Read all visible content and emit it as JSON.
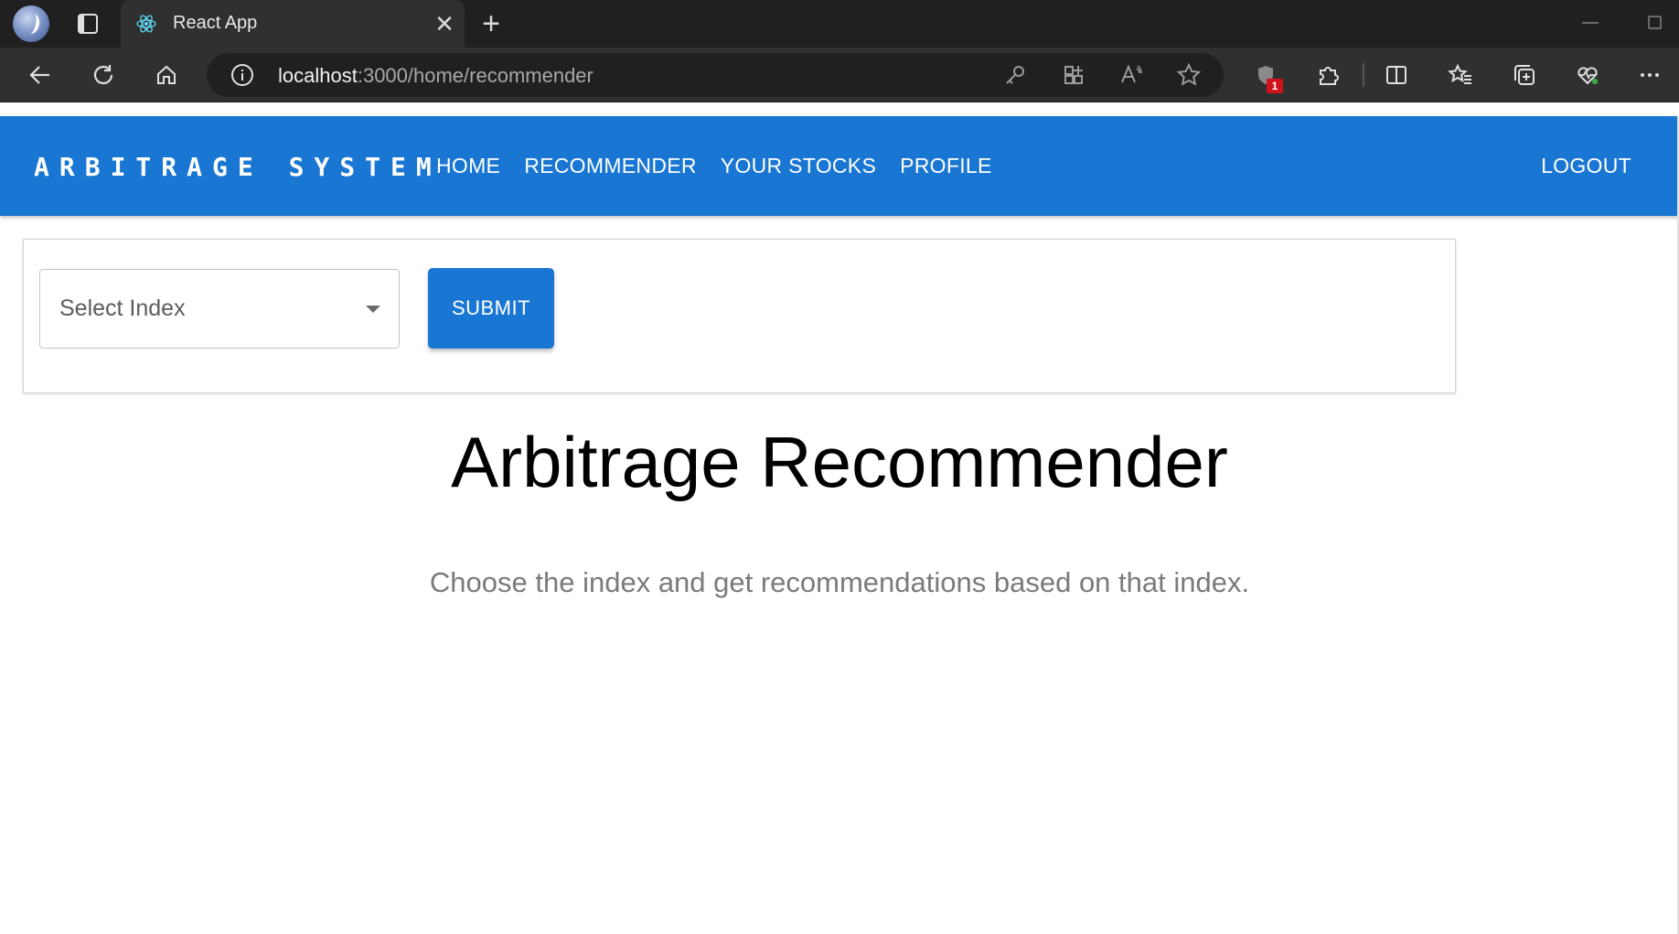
{
  "browser": {
    "tab_title": "React App",
    "url_host": "localhost",
    "url_path": ":3000/home/recommender",
    "notification_badge": "1",
    "icons": [
      "profile-avatar-icon",
      "tab-actions-icon",
      "react-favicon-icon",
      "close-icon",
      "new-tab-icon",
      "back-arrow-icon",
      "refresh-icon",
      "home-icon",
      "info-icon",
      "key-icon",
      "apps-icon",
      "read-aloud-icon",
      "star-icon",
      "shield-icon",
      "extensions-icon",
      "split-screen-icon",
      "favorites-icon",
      "collections-icon",
      "browser-essentials-icon",
      "more-icon"
    ]
  },
  "appbar": {
    "brand": "ARBITRAGE SYSTEM",
    "nav": [
      "HOME",
      "RECOMMENDER",
      "YOUR STOCKS",
      "PROFILE"
    ],
    "logout": "LOGOUT",
    "color": "#1976d2"
  },
  "form": {
    "select_label": "Select Index",
    "submit_label": "SUBMIT"
  },
  "main": {
    "title": "Arbitrage Recommender",
    "subtitle": "Choose the index and get recommendations based on that index."
  }
}
